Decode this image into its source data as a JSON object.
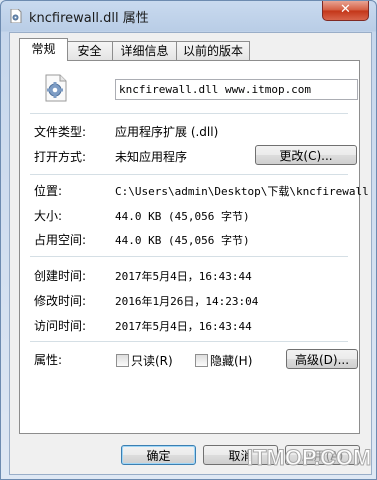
{
  "window": {
    "title": "kncfirewall.dll 属性",
    "close_glyph": "✕"
  },
  "tabs": [
    {
      "label": "常规",
      "active": true
    },
    {
      "label": "安全",
      "active": false
    },
    {
      "label": "详细信息",
      "active": false
    },
    {
      "label": "以前的版本",
      "active": false
    }
  ],
  "general": {
    "file_icon": "dll-file-gear-icon",
    "filename": "kncfirewall.dll www.itmop.com",
    "file_type": {
      "label": "文件类型:",
      "value": "应用程序扩展 (.dll)"
    },
    "opens_with": {
      "label": "打开方式:",
      "value": "未知应用程序",
      "button": "更改(C)..."
    },
    "location": {
      "label": "位置:",
      "value": "C:\\Users\\admin\\Desktop\\下载\\kncfirewall"
    },
    "size": {
      "label": "大小:",
      "value": "44.0 KB (45,056 字节)"
    },
    "size_on_disk": {
      "label": "占用空间:",
      "value": "44.0 KB (45,056 字节)"
    },
    "created": {
      "label": "创建时间:",
      "value": "2017年5月4日，16:43:44"
    },
    "modified": {
      "label": "修改时间:",
      "value": "2016年1月26日，14:23:04"
    },
    "accessed": {
      "label": "访问时间:",
      "value": "2017年5月4日，16:43:44"
    },
    "attributes": {
      "label": "属性:",
      "readonly": {
        "label": "只读(R)",
        "checked": false
      },
      "hidden": {
        "label": "隐藏(H)",
        "checked": false
      },
      "advanced_button": "高级(D)..."
    }
  },
  "footer": {
    "ok": "确定",
    "cancel": "取消",
    "apply": "应用(A)"
  },
  "watermark": "ITMOP.COM",
  "colors": {
    "close_button": "#c8442a",
    "tab_border": "#8d8d8d",
    "titlebar": "#c9daef"
  }
}
